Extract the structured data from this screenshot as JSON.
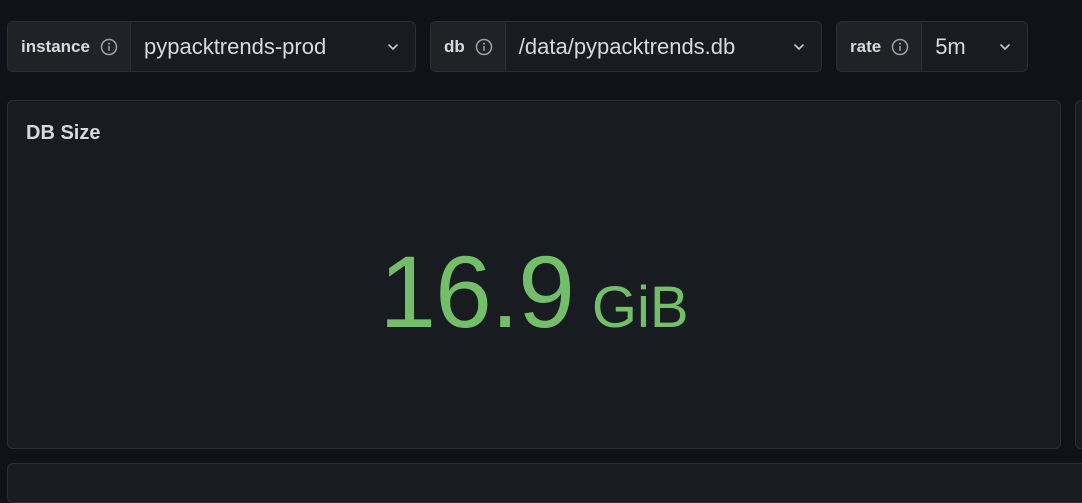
{
  "variables": [
    {
      "label": "instance",
      "value": "pypacktrends-prod"
    },
    {
      "label": "db",
      "value": "/data/pypacktrends.db"
    },
    {
      "label": "rate",
      "value": "5m"
    }
  ],
  "panel": {
    "title": "DB Size",
    "value": "16.9",
    "unit": "GiB"
  },
  "colors": {
    "background": "#111217",
    "panel": "#181b1f",
    "border": "#2c2e33",
    "stat_green": "#73bf69"
  },
  "icons": {
    "info": "info-circle-icon",
    "dropdown": "chevron-down-icon"
  }
}
